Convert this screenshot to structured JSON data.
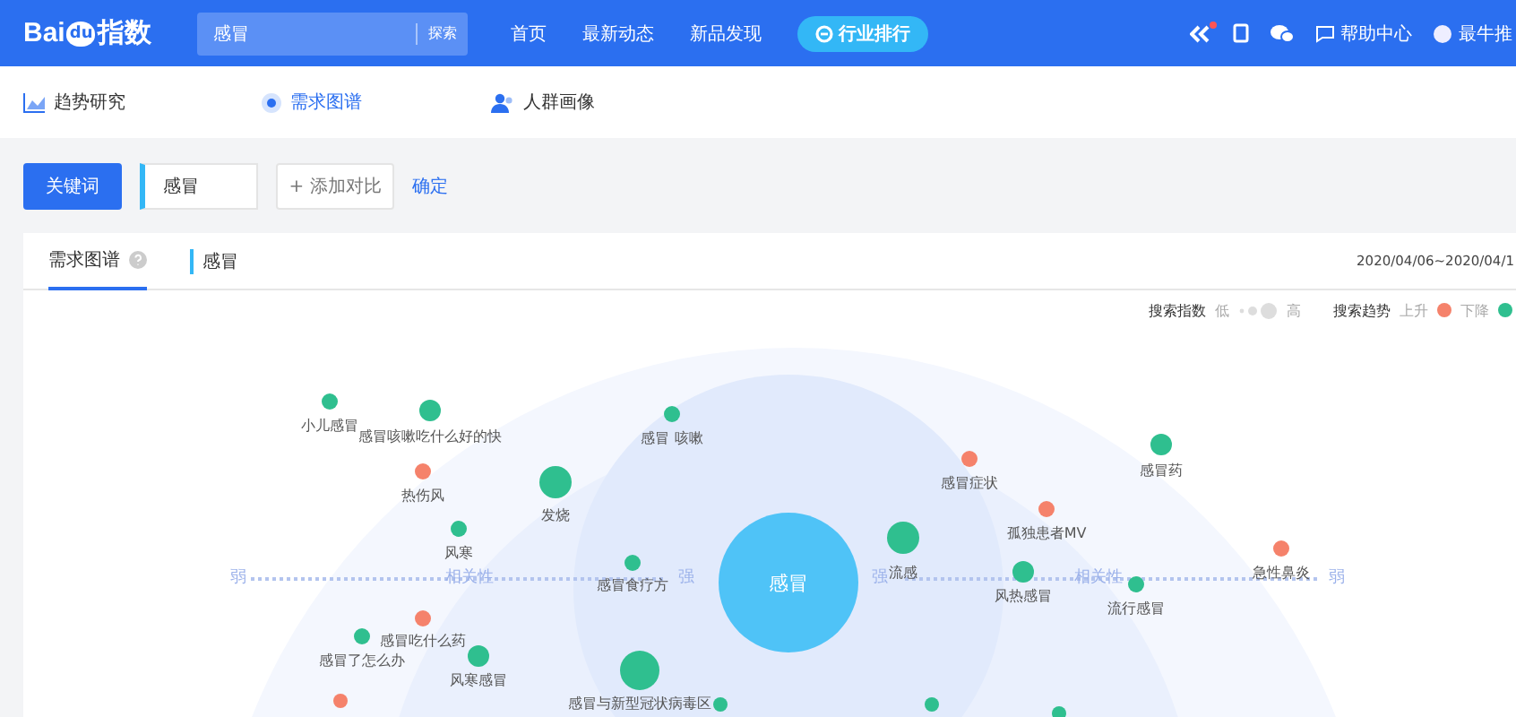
{
  "header": {
    "logo": {
      "left": "Bai",
      "badge": "du",
      "right": "指数"
    },
    "search": {
      "value": "感冒",
      "button": "探索"
    },
    "nav": [
      {
        "label": "首页",
        "kind": "link"
      },
      {
        "label": "最新动态",
        "kind": "link"
      },
      {
        "label": "新品发现",
        "kind": "link"
      },
      {
        "label": "行业排行",
        "kind": "pill"
      }
    ],
    "help": "帮助中心",
    "user": "最牛推"
  },
  "subnav": [
    {
      "label": "趋势研究",
      "selected": false
    },
    {
      "label": "需求图谱",
      "selected": true
    },
    {
      "label": "人群画像",
      "selected": false
    }
  ],
  "keyword_bar": {
    "button": "关键词",
    "keyword": "感冒",
    "add": "+ 添加对比",
    "confirm": "确定"
  },
  "card": {
    "tabs": [
      {
        "label": "需求图谱",
        "selected": true
      },
      {
        "label": "感冒",
        "selected": false
      }
    ],
    "date_range": "2020/04/06~2020/04/1",
    "legend": {
      "index_title": "搜索指数",
      "low": "低",
      "high": "高",
      "trend_title": "搜索趋势",
      "up": "上升",
      "down": "下降"
    },
    "axis": [
      "弱",
      "相关性",
      "强",
      "强",
      "相关性",
      "弱"
    ],
    "center": "感冒",
    "nodes": [
      {
        "label": "小儿感冒",
        "color": "#2fbf8f",
        "kind": "small"
      },
      {
        "label": "感冒咳嗽吃什么好的快",
        "color": "#2fbf8f",
        "kind": "medium"
      },
      {
        "label": "感冒 咳嗽",
        "color": "#2fbf8f",
        "kind": "small"
      },
      {
        "label": "热伤风",
        "color": "#f5826b",
        "kind": "small"
      },
      {
        "label": "发烧",
        "color": "#2fbf8f",
        "kind": "large"
      },
      {
        "label": "风寒",
        "color": "#2fbf8f",
        "kind": "small"
      },
      {
        "label": "感冒食疗方",
        "color": "#2fbf8f",
        "kind": "small"
      },
      {
        "label": "感冒吃什么药",
        "color": "#f5826b",
        "kind": "small"
      },
      {
        "label": "感冒了怎么办",
        "color": "#2fbf8f",
        "kind": "small"
      },
      {
        "label": "风寒感冒",
        "color": "#2fbf8f",
        "kind": "medium"
      },
      {
        "label": "感冒与新型冠状病毒区",
        "color": "#2fbf8f",
        "kind": "xlarge"
      },
      {
        "label": "流感",
        "color": "#2fbf8f",
        "kind": "large"
      },
      {
        "label": "感冒症状",
        "color": "#f5826b",
        "kind": "small"
      },
      {
        "label": "感冒药",
        "color": "#2fbf8f",
        "kind": "medium"
      },
      {
        "label": "孤独患者MV",
        "color": "#f5826b",
        "kind": "small"
      },
      {
        "label": "风热感冒",
        "color": "#2fbf8f",
        "kind": "medium"
      },
      {
        "label": "流行感冒",
        "color": "#2fbf8f",
        "kind": "small"
      },
      {
        "label": "急性鼻炎",
        "color": "#f5826b",
        "kind": "small"
      }
    ]
  }
}
